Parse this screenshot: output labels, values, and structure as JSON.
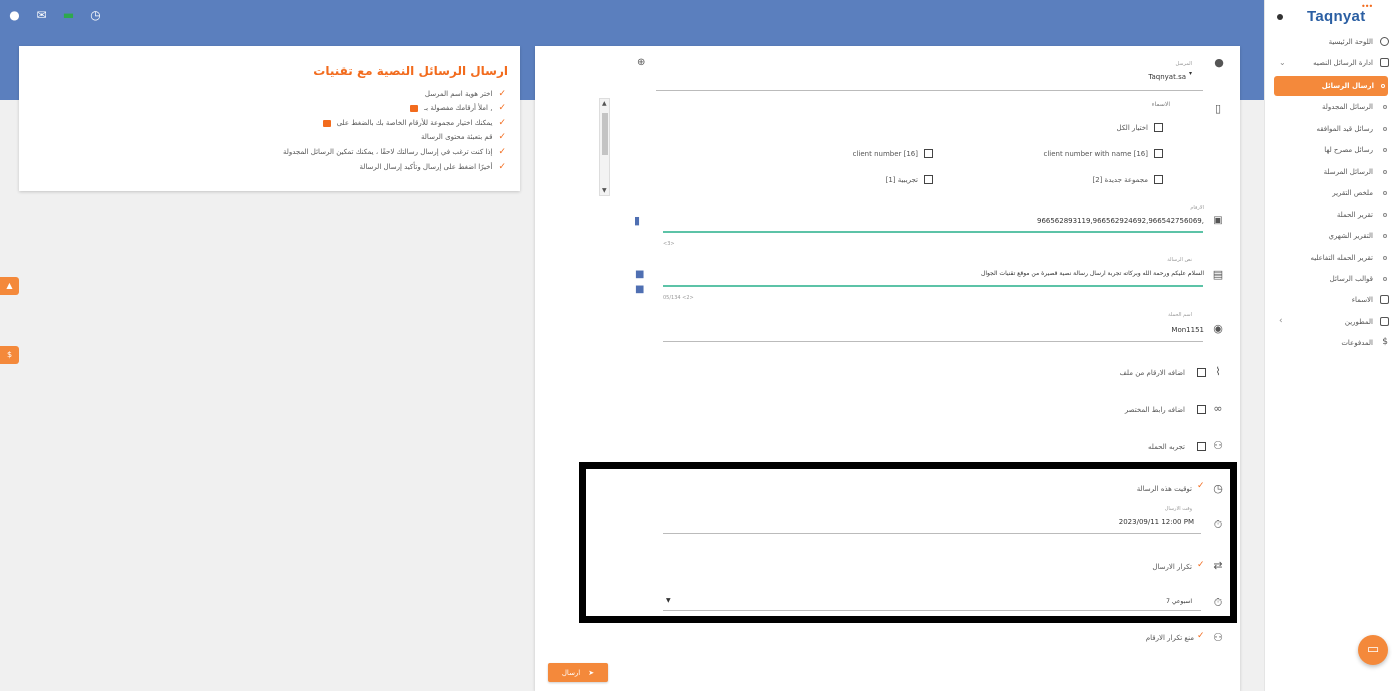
{
  "sidebar": {
    "logo": "Taqnyat",
    "items": [
      {
        "label": "اللوحة الرئيسية"
      },
      {
        "label": "ادارة الرسائل النصيه"
      },
      {
        "label": "ارسال الرسائل"
      },
      {
        "label": "الرسائل المجدولة"
      },
      {
        "label": "رسائل قيد الموافقه"
      },
      {
        "label": "رسائل مصرح لها"
      },
      {
        "label": "الرسائل المرسلة"
      },
      {
        "label": "ملخص التقرير"
      },
      {
        "label": "تقرير الحملة"
      },
      {
        "label": "التقرير الشهري"
      },
      {
        "label": "تقرير الحمله التفاعليه"
      },
      {
        "label": "قوالب الرسائل"
      },
      {
        "label": "الاسماء"
      },
      {
        "label": "المطورين"
      },
      {
        "label": "المدفوعات"
      }
    ]
  },
  "info_card": {
    "title": "ارسال الرسائل النصية مع تقنيات",
    "steps": [
      "اختر هوية اسم المرسل",
      "املأ أرقامك مفصولة بـ ,",
      "يمكنك اختيار مجموعة للأرقام الخاصة بك بالضغط على",
      "قم بتعبئة محتوى الرسالة",
      "إذا كنت ترغب في إرسال رسالتك لاحقًا ، يمكنك تمكين الرسائل المجدولة",
      "أخيرًا اضغط على إرسال وتأكيد إرسال الرسالة"
    ]
  },
  "form": {
    "sender_label": "المرسل",
    "sender_value": "Taqnyat.sa",
    "names_label": "الاسماء",
    "select_all": "اختيار الكل",
    "groups": {
      "g1": "client number with name [16]",
      "g2": "client number [16]",
      "g3": "مجموعة جديدة [2]",
      "g4": "تجريبية [1]"
    },
    "numbers_label": "الارقام",
    "numbers_value": "966562893119,966562924692,966542756069,",
    "numbers_count": "<3>",
    "message_label": "نص الرسالة",
    "message_value": "السلام عليكم ورحمة الله وبركاته تجربة ارسال رسالة نصية قصيرة من موقع تقنيات الجوال",
    "message_count": "05/134 <2>",
    "campaign_label": "اسم الحملة",
    "campaign_value": "Mon1151",
    "opt_file": "اضافه الارقام من ملف",
    "opt_shortlink": "اضافه رابط المختصر",
    "opt_test": "تجربه الحمله",
    "schedule_label": "توقيت هذه الرسالة",
    "send_time_label": "وقت الارسال",
    "send_time_value": "2023/09/11 12:00 PM",
    "repeat_label": "تكرار الارسال",
    "repeat_value": "7 اسبوعي",
    "prevent_dup": "منع تكرار الارقام",
    "send_button": "ارسال"
  },
  "colors": {
    "accent": "#f4893b",
    "header": "#5b7fbe",
    "brand": "#2b5fa3",
    "input_focus": "#5cc3a7"
  }
}
